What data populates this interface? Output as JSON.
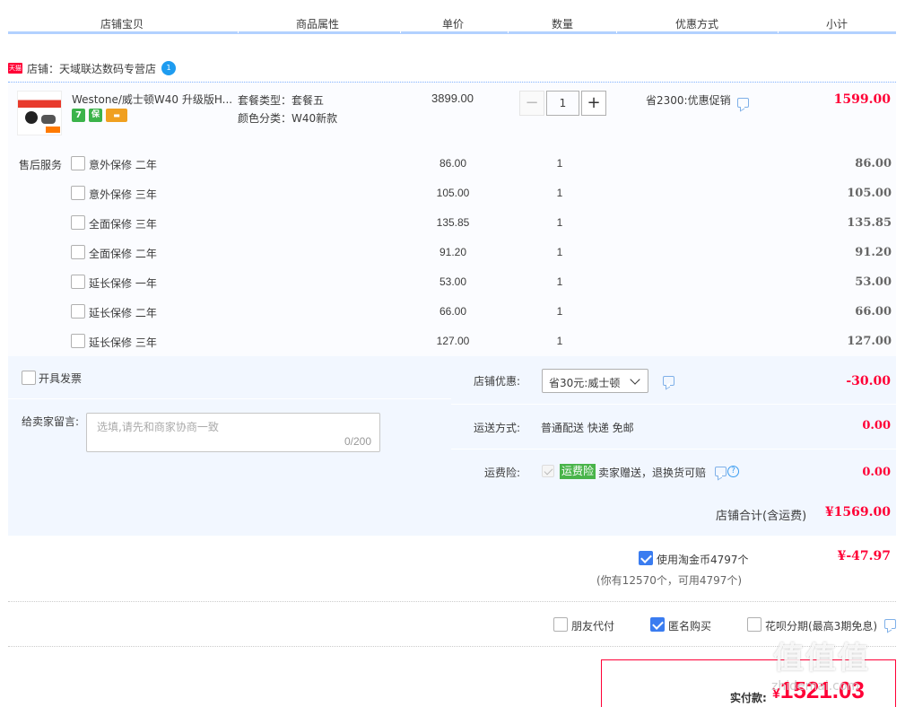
{
  "header": {
    "columns": [
      "店铺宝贝",
      "商品属性",
      "单价",
      "数量",
      "优惠方式",
      "小计"
    ]
  },
  "shop": {
    "badge": "天猫",
    "label": "店铺：天域联达数码专营店",
    "ww_icon": "1"
  },
  "item": {
    "title": "Westone/威士顿W40 升级版H...",
    "attr_package": "套餐类型：套餐五",
    "attr_color": "颜色分类：W40新款",
    "unit_price": "3899.00",
    "quantity": "1",
    "minus": "−",
    "plus": "+",
    "promo": "省2300:优惠促销",
    "subtotal": "1599.00",
    "icons": [
      {
        "name": "seven-days-icon",
        "glyph": "7",
        "color": "#3bb34a"
      },
      {
        "name": "guarantee-icon",
        "glyph": "保",
        "color": "#3bb34a"
      },
      {
        "name": "card-icon",
        "glyph": "▬",
        "color": "#f0a020"
      }
    ]
  },
  "services": {
    "label": "售后服务",
    "rows": [
      {
        "name": "意外保修 二年",
        "price": "86.00",
        "qty": "1",
        "subtotal": "86.00"
      },
      {
        "name": "意外保修 三年",
        "price": "105.00",
        "qty": "1",
        "subtotal": "105.00"
      },
      {
        "name": "全面保修 三年",
        "price": "135.85",
        "qty": "1",
        "subtotal": "135.85"
      },
      {
        "name": "全面保修 二年",
        "price": "91.20",
        "qty": "1",
        "subtotal": "91.20"
      },
      {
        "name": "延长保修 一年",
        "price": "53.00",
        "qty": "1",
        "subtotal": "53.00"
      },
      {
        "name": "延长保修 二年",
        "price": "66.00",
        "qty": "1",
        "subtotal": "66.00"
      },
      {
        "name": "延长保修 三年",
        "price": "127.00",
        "qty": "1",
        "subtotal": "127.00"
      }
    ]
  },
  "invoice": {
    "label": "开具发票"
  },
  "note": {
    "label": "给卖家留言:",
    "placeholder": "选填,请先和商家协商一致",
    "counter": "0/200"
  },
  "shop_discount": {
    "label": "店铺优惠:",
    "selected": "省30元:威士顿",
    "amount": "-30.00"
  },
  "shipping": {
    "label": "运送方式:",
    "value": "普通配送 快递 免邮",
    "amount": "0.00"
  },
  "insurance": {
    "label": "运费险:",
    "badge": "运费险",
    "desc": "卖家赠送，退换货可赔",
    "help": "?",
    "amount": "0.00"
  },
  "shop_total": {
    "label": "店铺合计(含运费)",
    "amount": "¥1569.00"
  },
  "coins": {
    "label": "使用淘金币4797个",
    "sub": "(你有12570个，可用4797个)",
    "amount": "¥-47.97"
  },
  "options": {
    "friend_pay": "朋友代付",
    "anonymous": "匿名购买",
    "huabei": "花呗分期(最高3期免息)"
  },
  "payment": {
    "label": "实付款:",
    "currency": "¥",
    "amount": "1521.03"
  },
  "watermark": {
    "text": "值值值",
    "site": "zhidemai.com"
  },
  "colors": {
    "accent_red": "#ff0036",
    "header_line": "#b2d1ff",
    "panel_bg": "#f2f7ff",
    "checkbox_blue": "#3a7cf0"
  }
}
